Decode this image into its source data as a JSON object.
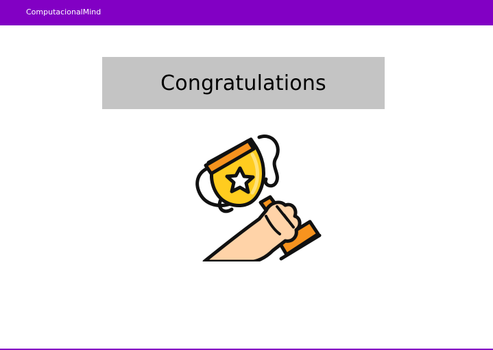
{
  "app_bar": {
    "title": "ComputacionalMind"
  },
  "main": {
    "banner_text": "Congratulations",
    "image_icon": "trophy-in-hand-icon"
  },
  "colors": {
    "primary": "#8200c4",
    "banner_bg": "#c4c4c4",
    "trophy_gold": "#ffcc1f",
    "trophy_orange": "#f7931e",
    "skin": "#ffd3a8"
  }
}
